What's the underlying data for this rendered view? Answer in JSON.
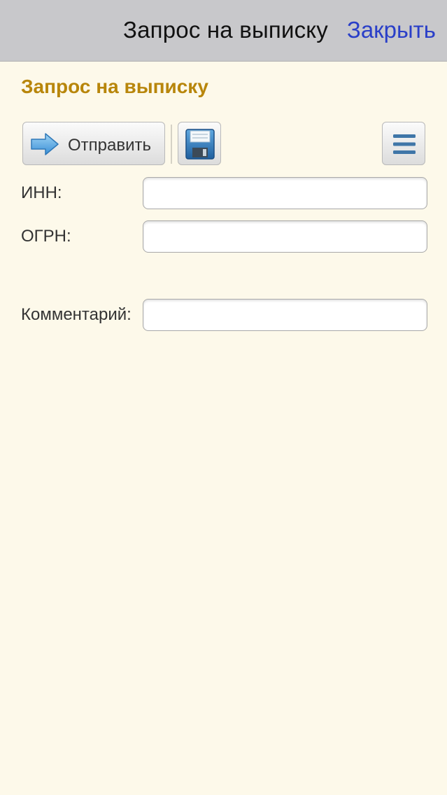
{
  "nav": {
    "title": "Запрос на выписку",
    "close_label": "Закрыть"
  },
  "form": {
    "title": "Запрос на выписку",
    "toolbar": {
      "send_label": "Отправить",
      "send_icon": "arrow-right-icon",
      "save_icon": "floppy-disk-icon",
      "menu_icon": "hamburger-menu-icon"
    },
    "fields": {
      "inn": {
        "label": "ИНН:",
        "value": "",
        "placeholder": ""
      },
      "ogrn": {
        "label": "ОГРН:",
        "value": "",
        "placeholder": ""
      },
      "comment": {
        "label": "Комментарий:",
        "value": "",
        "placeholder": ""
      }
    }
  },
  "colors": {
    "background": "#fdf9ea",
    "nav_background": "#c8c8cb",
    "title_accent": "#b8860b",
    "link": "#2a3fc8"
  }
}
